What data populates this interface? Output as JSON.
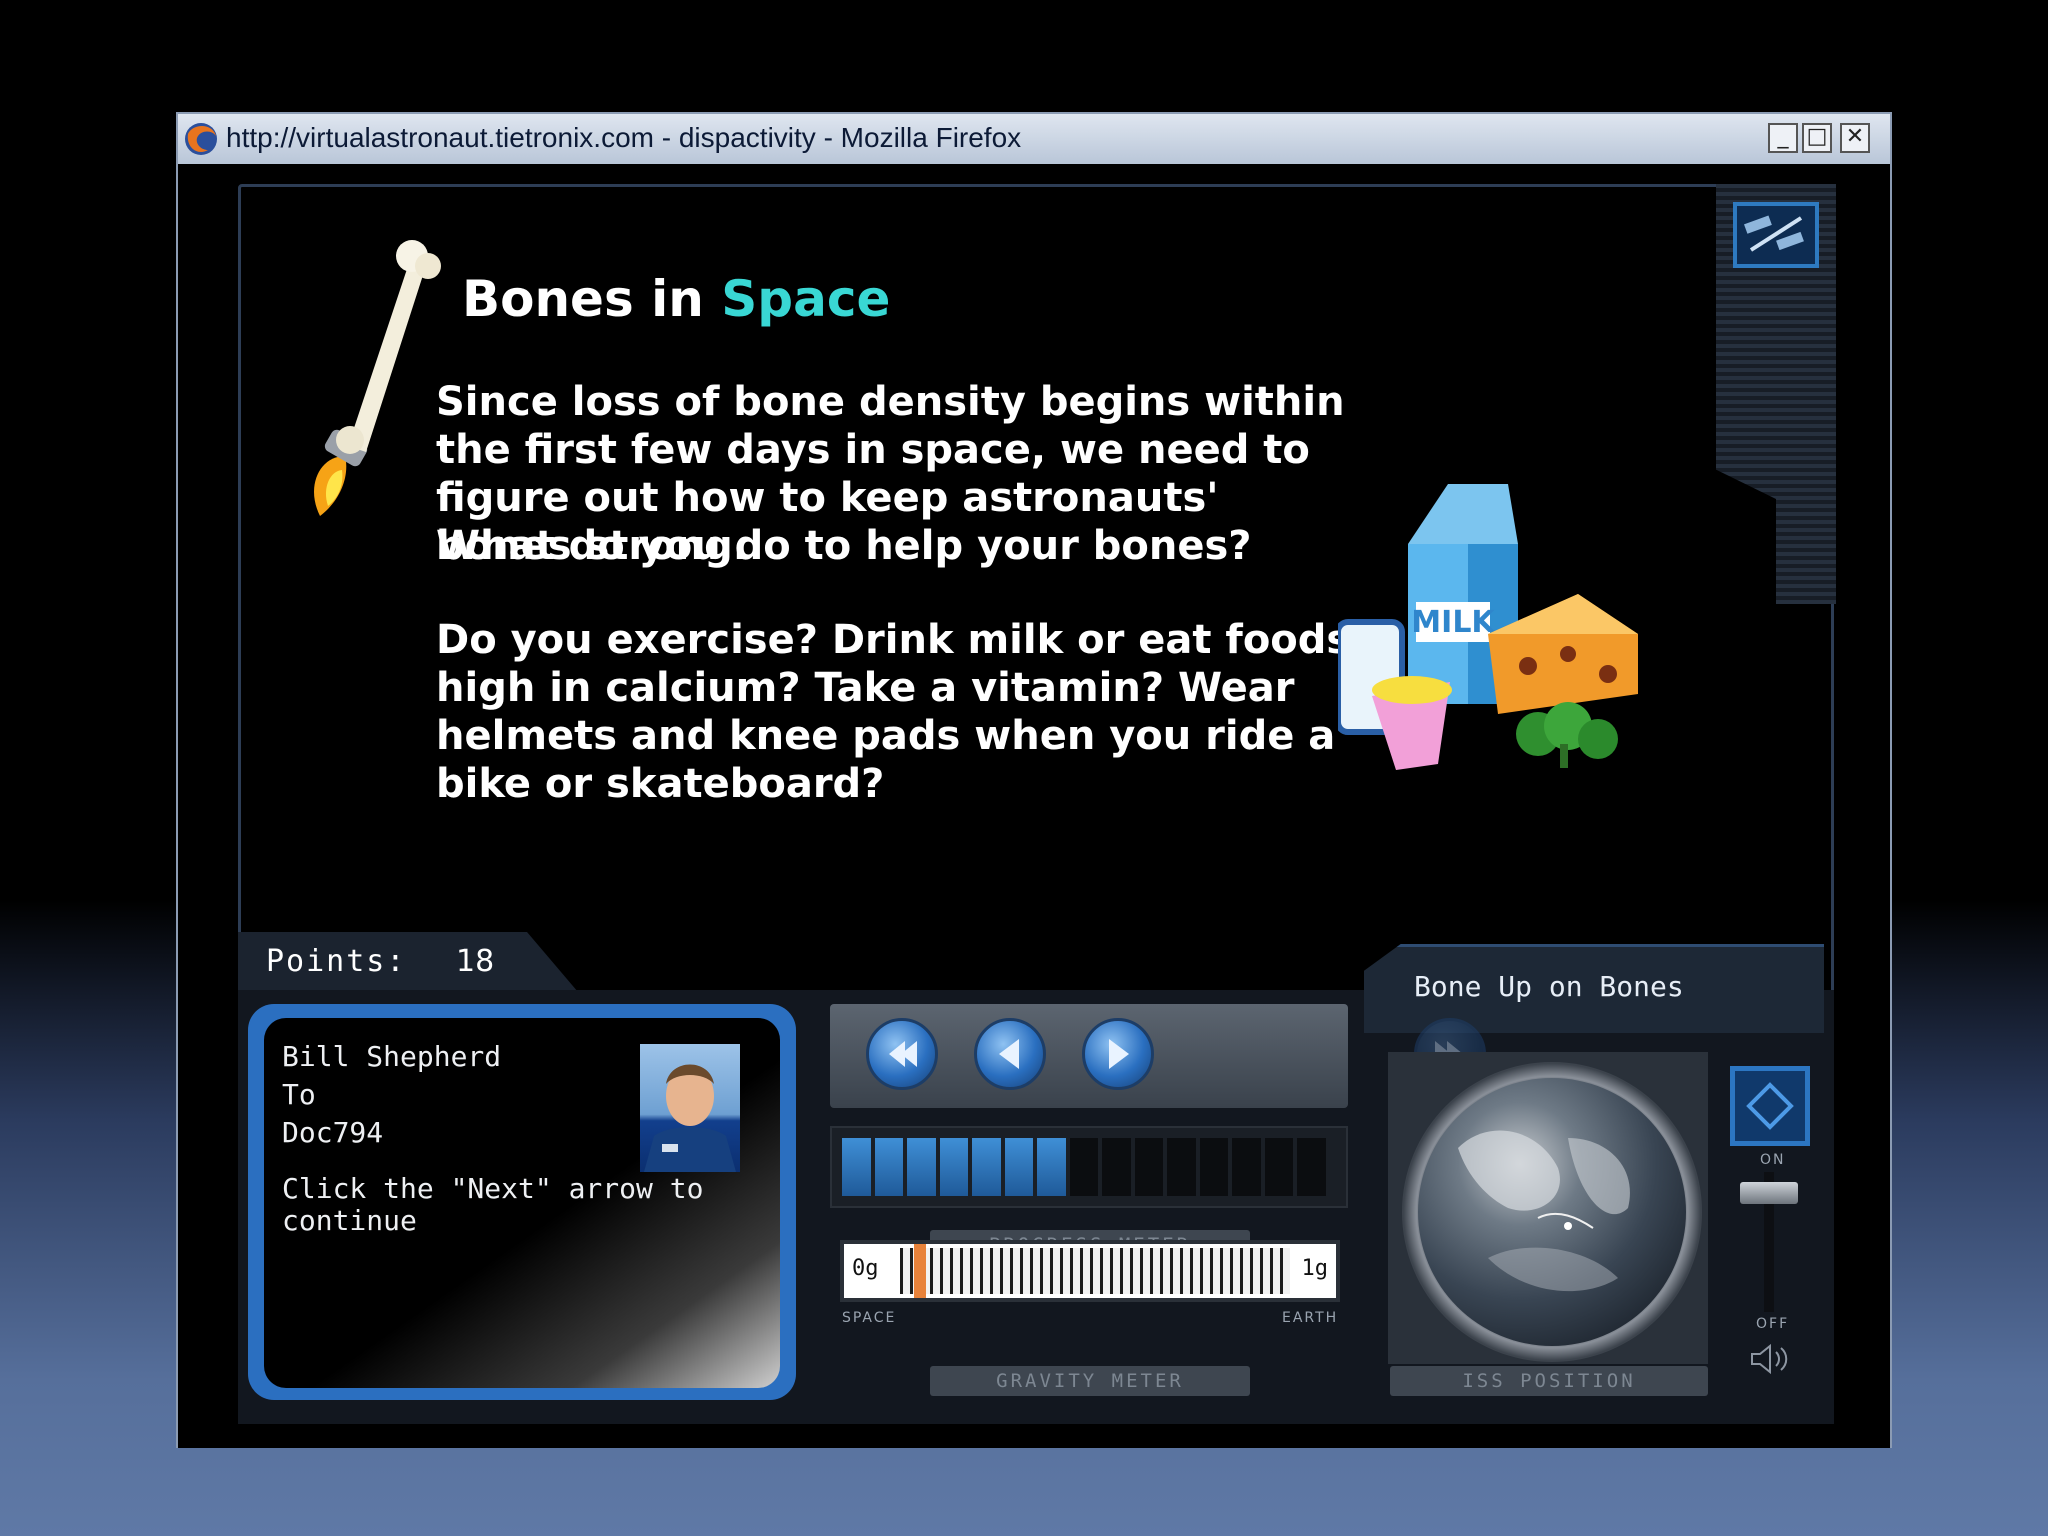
{
  "window": {
    "title": "http://virtualastronaut.tietronix.com - dispactivity - Mozilla Firefox",
    "controls": {
      "minimize": "_",
      "maximize": "□",
      "close": "✕"
    }
  },
  "slide": {
    "heading_prefix": "Bones in",
    "heading_accent": "Space",
    "paragraphs": [
      "Since loss of bone density begins within the first few days in space, we need to figure out how to keep astronauts' bones strong.",
      "What do you do to help your bones?",
      "Do you exercise? Drink milk or eat foods high in calcium? Take a vitamin?  Wear helmets and knee pads when you ride a bike or skateboard?"
    ],
    "milk_label": "MILK",
    "colors": {
      "accent": "#39d7d4",
      "text": "#ffffff"
    }
  },
  "score": {
    "label": "Points:",
    "value": "18"
  },
  "lesson": {
    "title": "Bone Up on Bones"
  },
  "message": {
    "from": "Bill Shepherd",
    "to_label": "To",
    "recipient": "Doc794",
    "text_line1": "Click the \"Next\" arrow to",
    "text_line2": "continue"
  },
  "navigation": {
    "buttons": [
      "first-icon",
      "back-icon",
      "next-icon",
      "last-icon"
    ]
  },
  "progress_meter": {
    "label": "PROGRESS METER",
    "filled_segments": 7,
    "total_segments": 15
  },
  "gravity_meter": {
    "label": "GRAVITY METER",
    "min_label": "0g",
    "max_label": "1g",
    "left_caption": "SPACE",
    "right_caption": "EARTH",
    "value_fraction": 0.05
  },
  "iss_position": {
    "label": "ISS POSITION"
  },
  "volume": {
    "on_label": "ON",
    "off_label": "OFF",
    "level_fraction": 0.85
  },
  "icons": {
    "iss": "iss-icon",
    "speaker": "speaker-icon",
    "side": "diamond-button-icon"
  }
}
